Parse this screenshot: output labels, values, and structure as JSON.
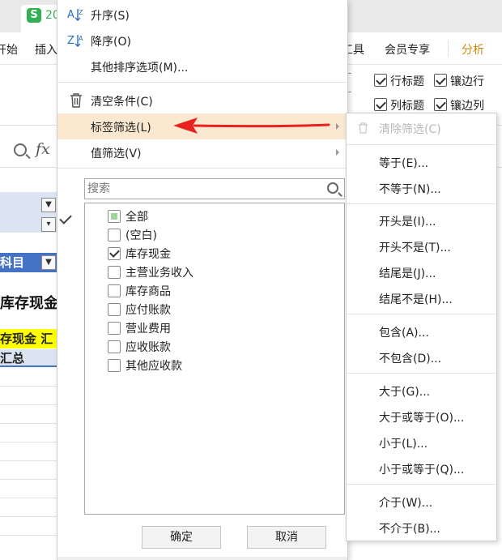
{
  "app": {
    "logo_letter": "S",
    "doc_tab_text": "20"
  },
  "menubar": {
    "items": [
      "开始",
      "插入",
      "工具",
      "会员专享",
      "分析"
    ]
  },
  "ribbon": {
    "options": [
      {
        "label": "行标题",
        "checked": true
      },
      {
        "label": "镶边行",
        "checked": true
      },
      {
        "label": "列标题",
        "checked": true
      },
      {
        "label": "镶边列",
        "checked": true
      }
    ]
  },
  "sheet": {
    "header_cell": "科目",
    "big_cell": "库存现金",
    "yellow_cell": "存现金 汇",
    "total_cell": "汇总"
  },
  "context_menu": {
    "sort_asc": "升序(S)",
    "sort_desc": "降序(O)",
    "more_sort": "其他排序选项(M)...",
    "clear_conditions": "清空条件(C)",
    "label_filter": "标签筛选(L)",
    "value_filter": "值筛选(V)",
    "search_placeholder": "搜索",
    "items": [
      {
        "label": "全部",
        "state": "partial"
      },
      {
        "label": "(空白)",
        "state": "unchecked"
      },
      {
        "label": "库存现金",
        "state": "checked"
      },
      {
        "label": "主营业务收入",
        "state": "unchecked"
      },
      {
        "label": "库存商品",
        "state": "unchecked"
      },
      {
        "label": "应付账款",
        "state": "unchecked"
      },
      {
        "label": "营业费用",
        "state": "unchecked"
      },
      {
        "label": "应收账款",
        "state": "unchecked"
      },
      {
        "label": "其他应收款",
        "state": "unchecked"
      }
    ],
    "ok": "确定",
    "cancel": "取消"
  },
  "label_filter_submenu": {
    "clear_filter": "清除筛选(C)",
    "equals": "等于(E)...",
    "not_equals": "不等于(N)...",
    "begins_with": "开头是(I)...",
    "not_begins_with": "开头不是(T)...",
    "ends_with": "结尾是(J)...",
    "not_ends_with": "结尾不是(H)...",
    "contains": "包含(A)...",
    "not_contains": "不包含(D)...",
    "greater": "大于(G)...",
    "greater_equal": "大于或等于(O)...",
    "less": "小于(L)...",
    "less_equal": "小于或等于(Q)...",
    "between": "介于(W)...",
    "not_between": "不介于(B)..."
  },
  "colors": {
    "highlight": "#fbe8d0",
    "annotation_arrow": "#e8231f",
    "pivot_header": "#4472c4",
    "accent": "#c68a13"
  }
}
